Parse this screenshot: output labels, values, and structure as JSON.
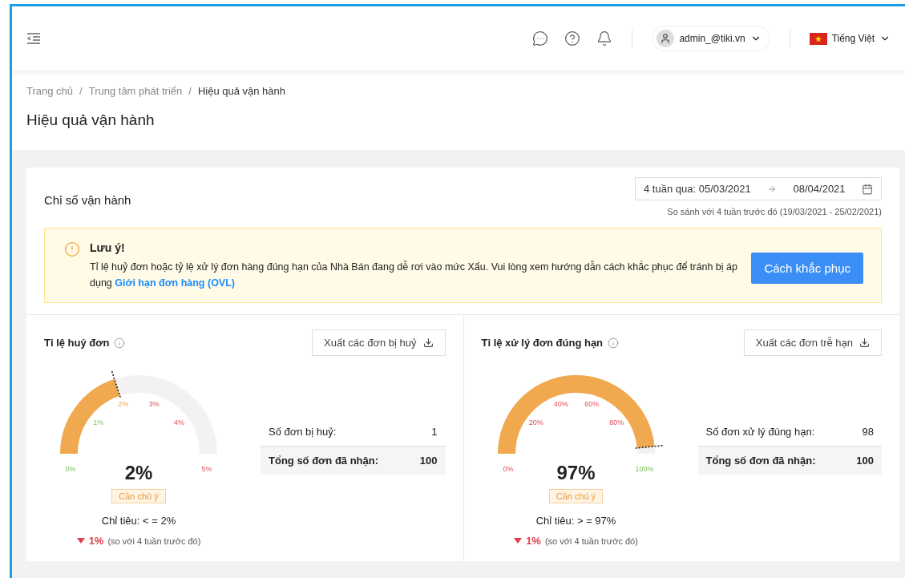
{
  "header": {
    "user": "admin_@tiki.vn",
    "language": "Tiếng Việt"
  },
  "breadcrumb": [
    {
      "label": "Trang chủ",
      "current": false
    },
    {
      "separator": "/",
      "label": "Trung tâm phát triển",
      "current": false
    },
    {
      "separator": "/",
      "label": "Hiệu quả vận hành",
      "current": true
    }
  ],
  "page_title": "Hiệu quả vận hành",
  "section": {
    "title": "Chỉ số vận hành",
    "date_from": "4 tuần qua: 05/03/2021",
    "date_to": "08/04/2021",
    "compare_note": "So sánh với 4 tuần trước đó (19/03/2021 - 25/02/2021)"
  },
  "alert": {
    "title": "Lưu ý!",
    "message": "Tỉ lệ huỷ đơn hoặc tỷ lệ xử lý đơn hàng đúng hạn của Nhà Bán đang dễ rơi vào mức Xấu. Vui lòng xem hướng dẫn cách khắc phục để tránh bị áp dụng",
    "link": "Giới hạn đơn hàng (OVL)",
    "button": "Cách khắc phục"
  },
  "metrics": [
    {
      "title": "Tỉ lệ huỷ đơn",
      "export_button": "Xuất các đơn bị huỷ",
      "ticks": [
        {
          "label": "0%",
          "kind": "good"
        },
        {
          "label": "1%",
          "kind": "good"
        },
        {
          "label": "2%",
          "kind": "warning"
        },
        {
          "label": "3%",
          "kind": "bad"
        },
        {
          "label": "4%",
          "kind": "bad"
        },
        {
          "label": "5%",
          "kind": "bad"
        }
      ],
      "value": "2%",
      "status": "Cần chú ý",
      "target": "Chỉ tiêu: < = 2%",
      "decreased": true,
      "change": "1%",
      "change_note": "(so với 4 tuần trước đó)",
      "stats": [
        {
          "label": "Số đơn bị huỷ:",
          "value": "1"
        },
        {
          "label": "Tổng số đơn đã nhận:",
          "value": "100"
        }
      ]
    },
    {
      "title": "Tỉ lệ xử lý đơn đúng hạn",
      "export_button": "Xuất các đơn trễ hạn",
      "ticks": [
        {
          "label": "0%",
          "kind": "bad"
        },
        {
          "label": "20%",
          "kind": "bad"
        },
        {
          "label": "40%",
          "kind": "bad"
        },
        {
          "label": "60%",
          "kind": "bad"
        },
        {
          "label": "80%",
          "kind": "bad"
        },
        {
          "label": "100%",
          "kind": "good"
        }
      ],
      "value": "97%",
      "status": "Cần chú ý",
      "target": "Chỉ tiêu: > = 97%",
      "decreased": true,
      "change": "1%",
      "change_note": "(so với 4 tuần trước đó)",
      "stats": [
        {
          "label": "Số đơn xử lý đúng hạn:",
          "value": "98"
        },
        {
          "label": "Tổng số đơn đã nhận:",
          "value": "100"
        }
      ]
    }
  ]
}
